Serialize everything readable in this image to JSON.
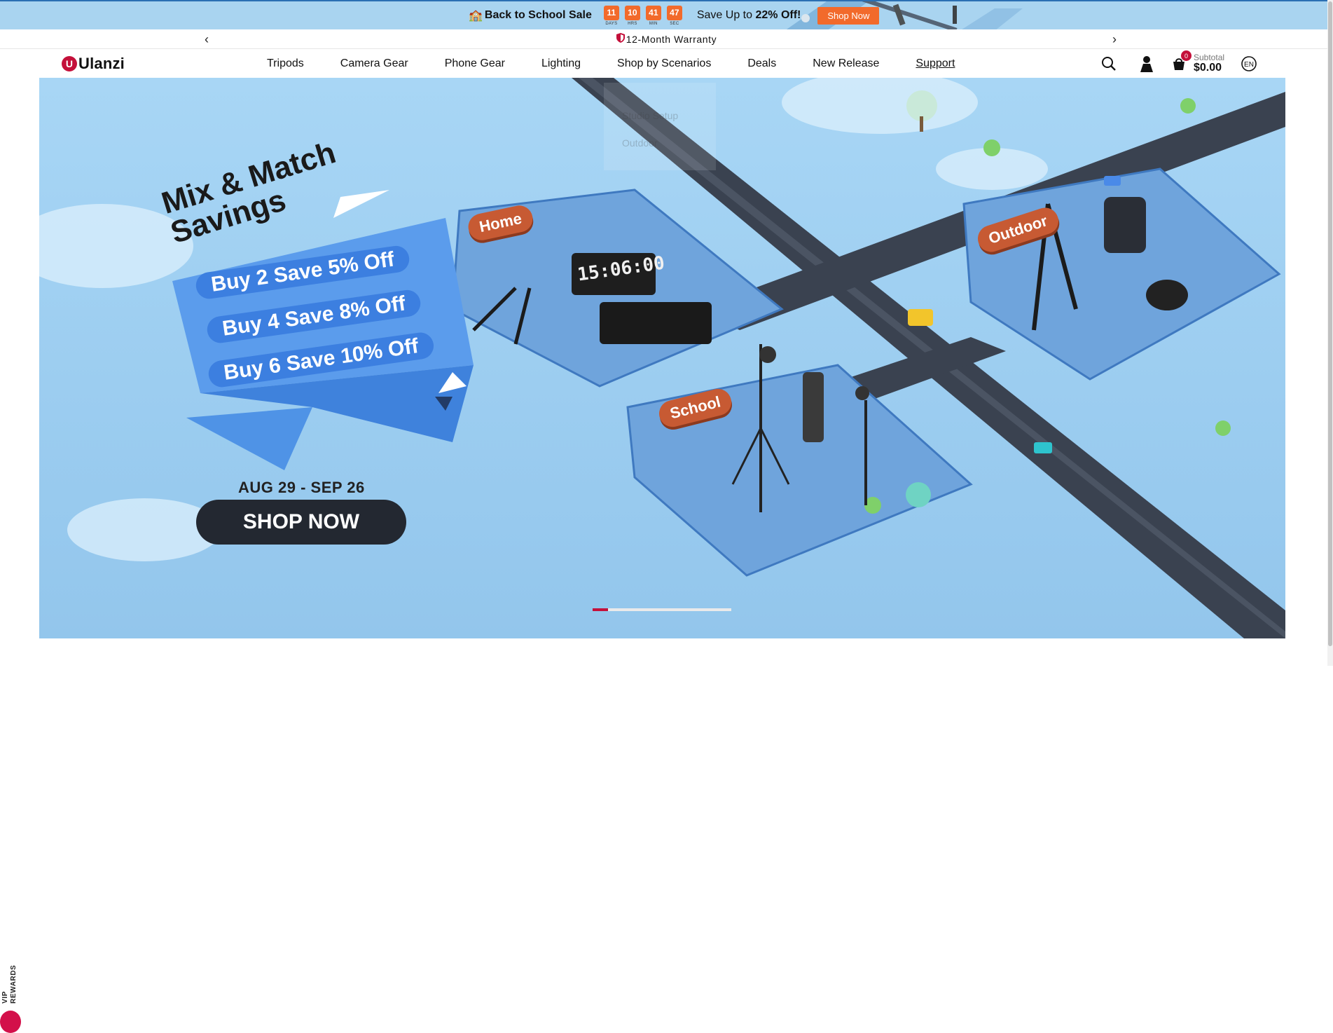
{
  "promo": {
    "title": "Back to School Sale",
    "countdown": [
      {
        "value": "11",
        "label": "DAYS"
      },
      {
        "value": "10",
        "label": "HRS"
      },
      {
        "value": "41",
        "label": "MIN"
      },
      {
        "value": "47",
        "label": "SEC"
      }
    ],
    "save_text": "Save Up to ",
    "save_pct": "22% Off!",
    "button": "Shop Now"
  },
  "announce": {
    "text": "12-Month Warranty",
    "prev_icon": "chevron-left-icon",
    "next_icon": "chevron-right-icon"
  },
  "header": {
    "logo": "Ulanzi",
    "nav": [
      "Tripods",
      "Camera Gear",
      "Phone Gear",
      "Lighting",
      "Shop by Scenarios",
      "Deals",
      "New Release",
      "Support"
    ],
    "active_nav": "Support",
    "cart_count": "0",
    "subtotal_label": "Subtotal",
    "subtotal_value": "$0.00",
    "lang": "EN"
  },
  "dropdown": {
    "items": [
      "Studio Setup",
      "Outdoor"
    ]
  },
  "hero": {
    "headline_1": "Mix & Match",
    "headline_2": "Savings",
    "offers": [
      "Buy 2 Save 5% Off",
      "Buy 4 Save 8% Off",
      "Buy 6 Save 10% Off"
    ],
    "date": "AUG 29 - SEP 26",
    "cta": "SHOP NOW",
    "signs": [
      "Home",
      "Outdoor",
      "School"
    ],
    "clock": "15:06:00",
    "slide_active": 1,
    "slide_count": 9
  },
  "vip": {
    "label_1": "VIP",
    "label_2": "REWARDS"
  },
  "colors": {
    "brand": "#c4103a",
    "accent": "#f26a2b",
    "sky": "#a8d6f5",
    "dark": "#232831"
  }
}
